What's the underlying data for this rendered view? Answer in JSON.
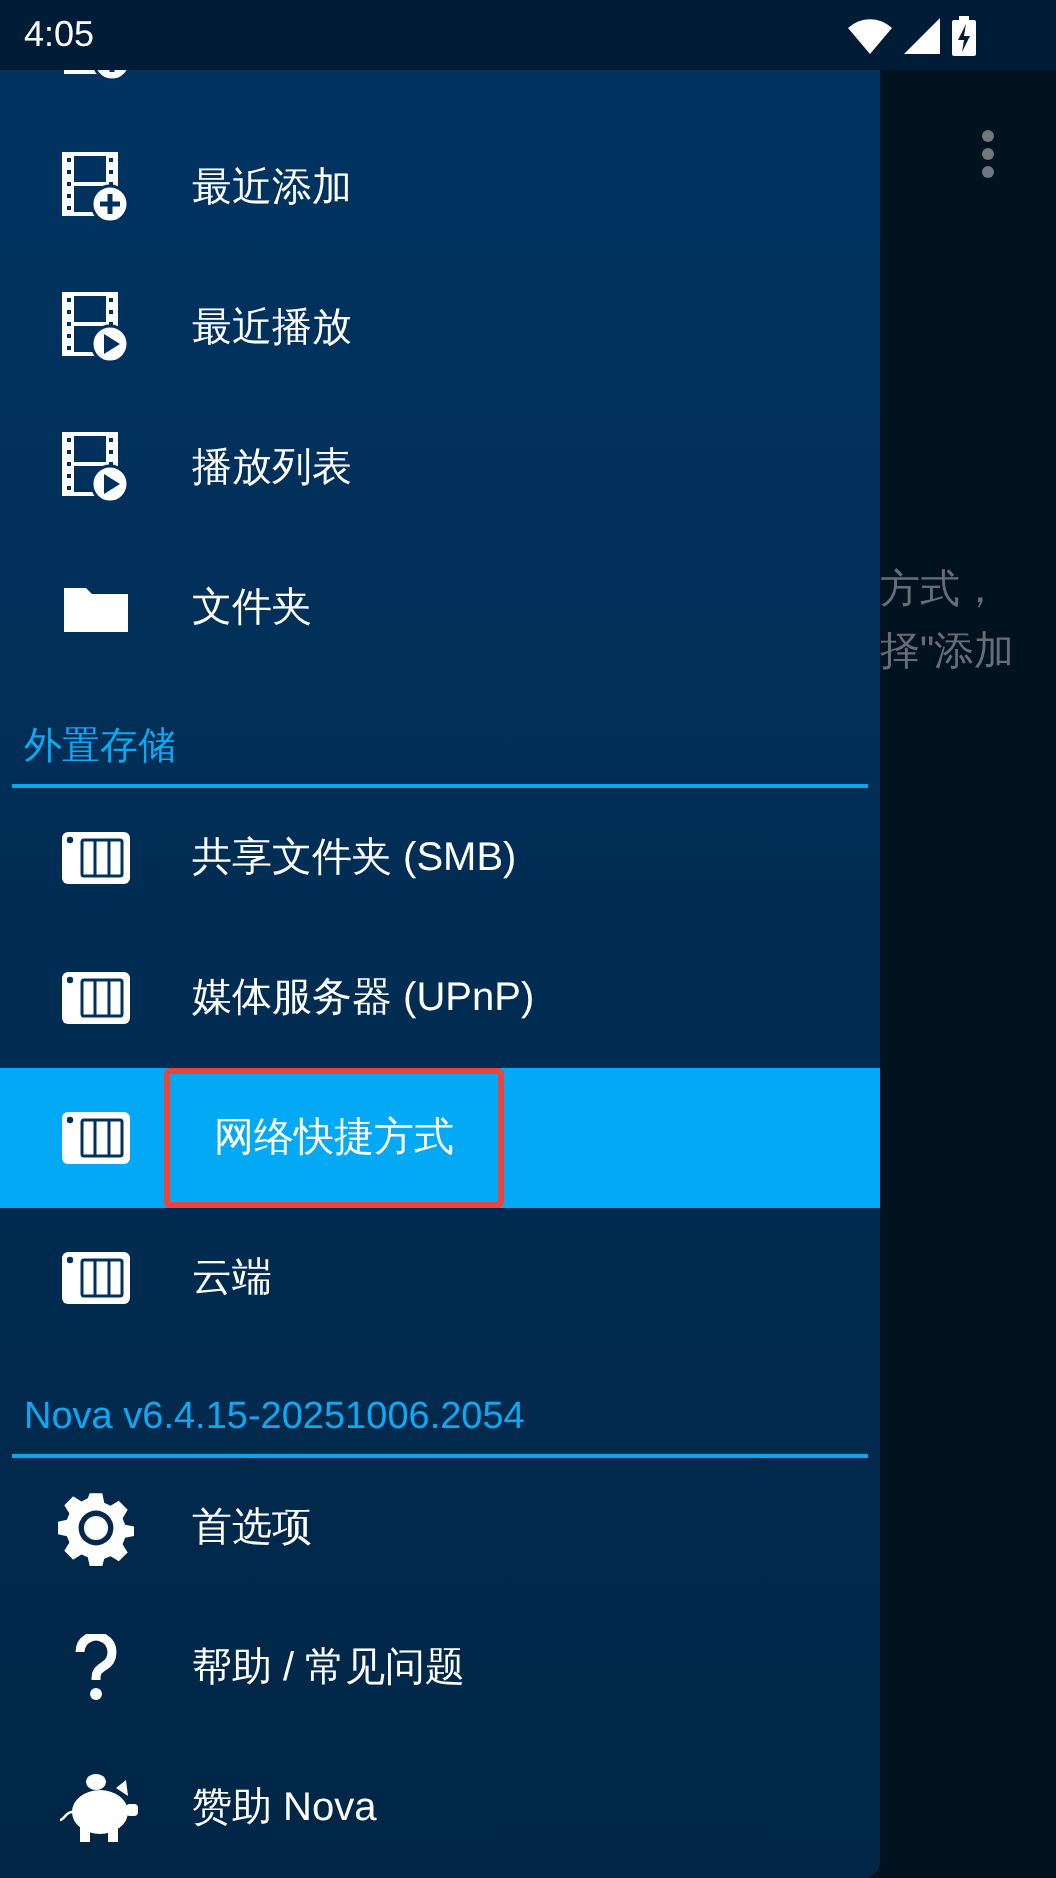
{
  "status_bar": {
    "time": "4:05"
  },
  "drawer": {
    "sections": [
      {
        "items": [
          {
            "label": "最近添加",
            "kind": "film-plus",
            "selected": false,
            "annotated": false
          },
          {
            "label": "最近播放",
            "kind": "film-play",
            "selected": false,
            "annotated": false
          },
          {
            "label": "播放列表",
            "kind": "film-play",
            "selected": false,
            "annotated": false
          },
          {
            "label": "文件夹",
            "kind": "folder",
            "selected": false,
            "annotated": false
          }
        ]
      },
      {
        "header": "外置存储",
        "items": [
          {
            "label": "共享文件夹 (SMB)",
            "kind": "nas",
            "selected": false,
            "annotated": false
          },
          {
            "label": "媒体服务器 (UPnP)",
            "kind": "nas",
            "selected": false,
            "annotated": false
          },
          {
            "label": "网络快捷方式",
            "kind": "nas",
            "selected": true,
            "annotated": true
          },
          {
            "label": "云端",
            "kind": "nas",
            "selected": false,
            "annotated": false
          }
        ]
      },
      {
        "header": "Nova v6.4.15-20251006.2054",
        "items": [
          {
            "label": "首选项",
            "kind": "gear",
            "selected": false,
            "annotated": false
          },
          {
            "label": "帮助 / 常见问题",
            "kind": "help",
            "selected": false,
            "annotated": false
          },
          {
            "label": "赞助 Nova",
            "kind": "piggy",
            "selected": false,
            "annotated": false
          }
        ]
      }
    ]
  },
  "background": {
    "text_lines": [
      "方式，",
      "择\"添加"
    ]
  }
}
